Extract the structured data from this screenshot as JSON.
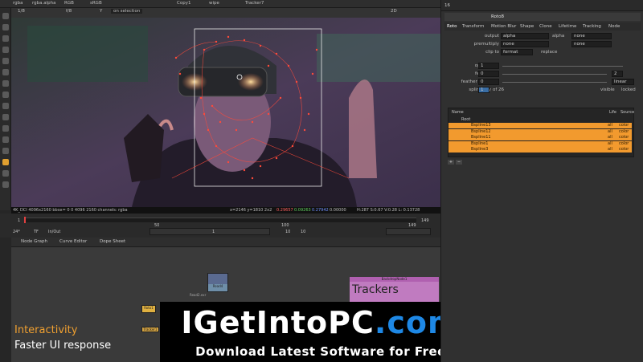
{
  "toolbar": {
    "channels": "rgba",
    "channel_alpha": "rgba.alpha",
    "rgb": "RGB",
    "colorspace": "sRGB",
    "input_a": "Copy1",
    "input_b": "wipe",
    "input_c": "Tracker7",
    "view_mode": "2D",
    "frame_left": "1/8",
    "gain": "f/8",
    "y": "Y",
    "zero": "0",
    "one": "1",
    "on_selection": "on selection"
  },
  "viewer_info": {
    "format": "4K_DCI 4096x2160  bbox= 0 0 4096 2160 channels: rgba",
    "coords": "x=2146 y=1810 2x2",
    "r": "0.29657",
    "g": "0.09263",
    "b": "0.27942",
    "a": "0.00000",
    "hsvl": "H:287 S:0.67 V:0.28  L: 0.13728"
  },
  "timeline": {
    "start": "1",
    "end": "149",
    "end2": "149",
    "tick50": "50",
    "tick100": "100",
    "zoom": "24*",
    "tf": "TF",
    "inout": "In/Out",
    "frame": "1",
    "step": "10",
    "step2": "10"
  },
  "tabs": [
    "Node Graph",
    "Curve Editor",
    "Dope Sheet"
  ],
  "nodegraph": {
    "backdrop_title": "Trackers",
    "backdrop_header": "BackdropNode1",
    "read_label": "Read4",
    "read_sub": "Read2.exr",
    "node1": "Roto1",
    "node2": "Tracker1"
  },
  "panel": {
    "panel_number": "16",
    "node_name": "Roto8",
    "tabs": [
      "Roto",
      "Transform",
      "Motion Blur",
      "Shape",
      "Clone",
      "Lifetime",
      "Tracking",
      "Node"
    ],
    "output_label": "output",
    "output_value": "alpha",
    "output_alpha": "alpha",
    "output_none": "none",
    "premultiply_label": "premultiply",
    "premultiply_value": "none",
    "premult_none": "none",
    "clip_label": "clip to",
    "clip_value": "format",
    "replace_label": "replace",
    "opacity_label": "opacity",
    "opacity_value": "1",
    "feather_label": "feather",
    "feather_value": "0",
    "feather_right": "2",
    "falloff_label": "feather falloff",
    "falloff_value": "0",
    "falloff_mode": "linear",
    "splinekey_label": "spline key",
    "splinekey_value": "1",
    "splinekey_of": "of 26",
    "visible_label": "visible",
    "locked_label": "locked",
    "tree_headers": [
      "Name",
      "Life",
      "Source"
    ],
    "root": "Root",
    "layers": [
      {
        "name": "Bspline13",
        "life": "all",
        "source": "color"
      },
      {
        "name": "Bspline12",
        "life": "all",
        "source": "color"
      },
      {
        "name": "Bspline11",
        "life": "all",
        "source": "color"
      },
      {
        "name": "Bspline1",
        "life": "all",
        "source": "color"
      },
      {
        "name": "Bspline3",
        "life": "all",
        "source": "color"
      }
    ]
  },
  "overlay": {
    "caption_title": "Interactivity",
    "caption_sub": "Faster UI response",
    "brand_main": "IGetIntoPC.com",
    "brand_tagline": "Download Latest Software for Free",
    "corner_logo": "F."
  },
  "colors": {
    "layer_highlight": "#f29a2e",
    "roto_points": "#ff3b30",
    "backdrop": "#c07bc0",
    "brand_blue": "#1e88e5"
  }
}
